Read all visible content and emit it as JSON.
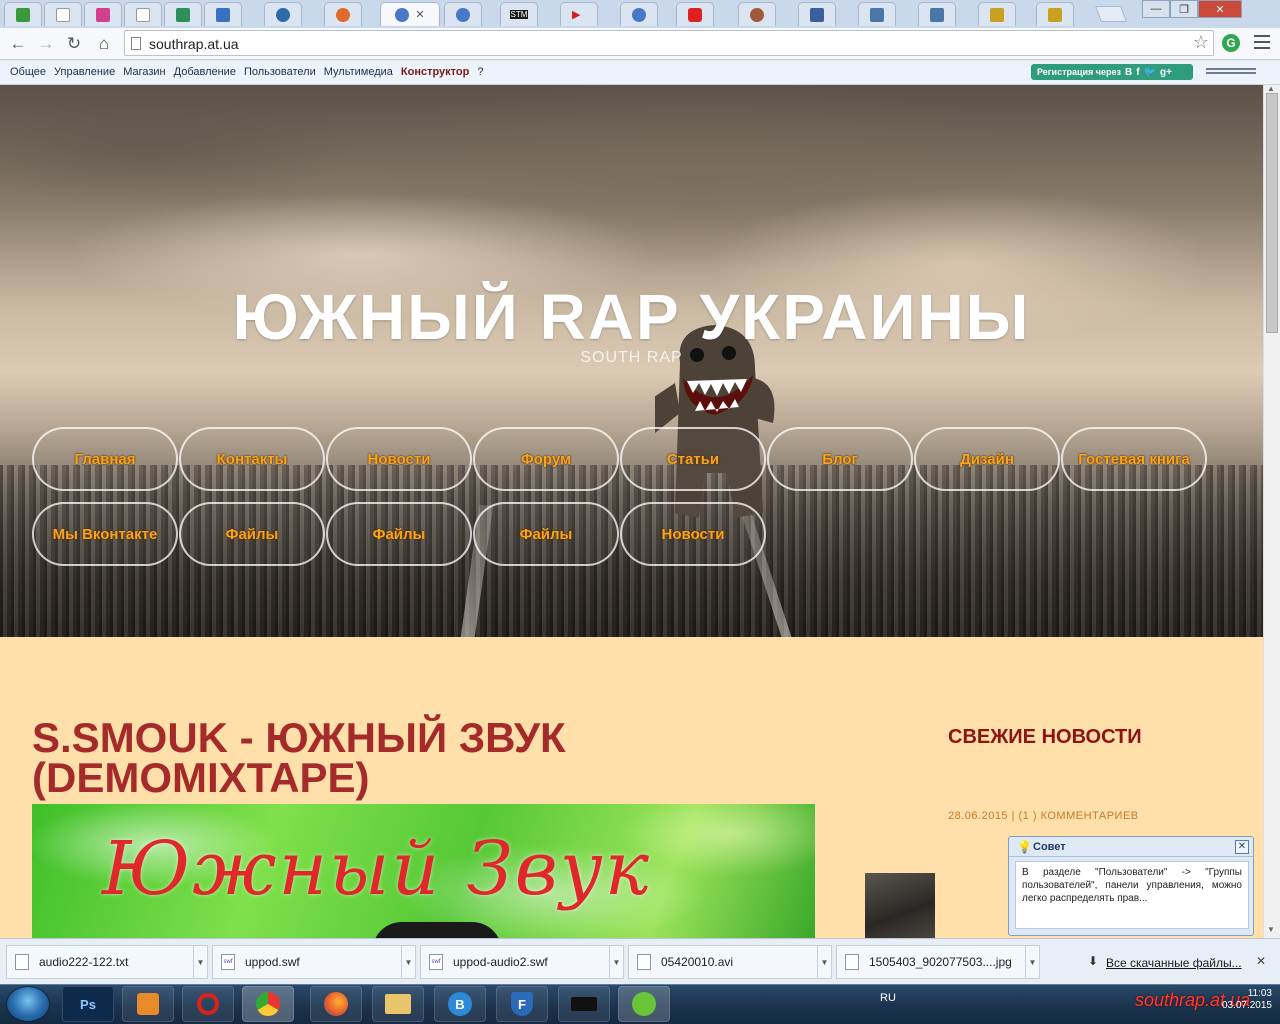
{
  "browser": {
    "tabs": [
      {
        "label": "",
        "color": "#3a9a3a"
      },
      {
        "label": "",
        "color": "#cfd6df"
      },
      {
        "label": "",
        "color": "#d23f8c"
      },
      {
        "label": "",
        "color": "#cfd6df"
      },
      {
        "label": "",
        "color": "#2e8f5a"
      },
      {
        "label": "",
        "color": "#3a70c0"
      },
      {
        "label": "",
        "color": "#2f6aa8"
      },
      {
        "label": "",
        "color": "#e06a2a"
      },
      {
        "label": "",
        "color": "#4a78c8",
        "active": true
      },
      {
        "label": "",
        "color": "#4a78c8"
      },
      {
        "label": "STM",
        "color": "#1a1a1a"
      },
      {
        "label": "",
        "color": "#d02020"
      },
      {
        "label": "",
        "color": "#4a78c8"
      },
      {
        "label": "",
        "color": "#e02020"
      },
      {
        "label": "",
        "color": "#a05a3a"
      },
      {
        "label": "",
        "color": "#3a5f9a"
      },
      {
        "label": "",
        "color": "#4a76a8"
      },
      {
        "label": "",
        "color": "#4a76a8"
      },
      {
        "label": "",
        "color": "#c9a020"
      },
      {
        "label": "",
        "color": "#c9a020"
      }
    ],
    "url": "southrap.at.ua",
    "ext_label": "G"
  },
  "adminbar": {
    "items": [
      "Общее",
      "Управление",
      "Магазин",
      "Добавление",
      "Пользователи",
      "Мультимедиа",
      "Конструктор",
      "?"
    ],
    "highlighted": "Конструктор",
    "register_label": "Регистрация через",
    "social": [
      "B",
      "f",
      "🐦",
      "g+"
    ]
  },
  "site": {
    "title": "ЮЖНЫЙ RAP УКРАИНЫ",
    "subtitle": "SOUTH RAP",
    "nav_row1": [
      "Главная",
      "Контакты",
      "Новости",
      "Форум",
      "Статьи",
      "Блог",
      "Дизайн",
      "Гостевая книга"
    ],
    "nav_row2": [
      "Мы Вконтакте",
      "Файлы",
      "Файлы",
      "Файлы",
      "Новости"
    ],
    "nav_color": "#f7a51c"
  },
  "content": {
    "post_title_line1": "S.SMOUK - ЮЖНЫЙ ЗВУК",
    "post_title_line2": "(DEMOMIXTAPE)",
    "post_image_text": "Южный Звук",
    "sidebar_title": "СВЕЖИЕ НОВОСТИ",
    "sidebar_meta": "28.06.2015 | (1 ) КОММЕНТАРИЕВ"
  },
  "tip": {
    "title": "Совет",
    "body": "В разделе \"Пользователи\" -> \"Группы пользователей\", панели управления, можно легко распределять прав..."
  },
  "downloads": {
    "items": [
      "audio222-122.txt",
      "uppod.swf",
      "uppod-audio2.swf",
      "05420010.avi",
      "1505403_902077503....jpg"
    ],
    "all_label": "Все скачанные файлы..."
  },
  "taskbar": {
    "apps": [
      "Ps",
      "",
      "",
      "",
      "",
      "",
      "B",
      "F",
      "",
      ""
    ],
    "lang": "RU",
    "watermark": "southrap.at.ua",
    "time": "11:03",
    "date": "03.07.2015"
  }
}
